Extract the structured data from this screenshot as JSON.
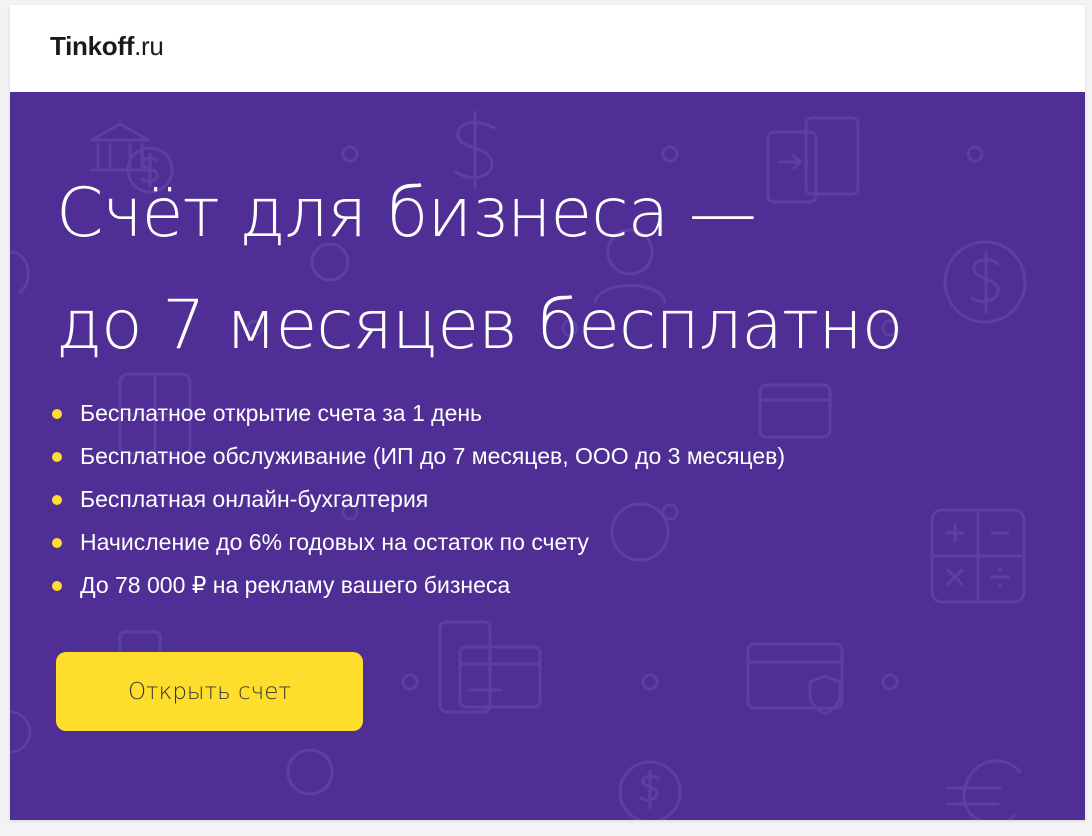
{
  "header": {
    "logo_brand": "Tinkoff",
    "logo_tld": ".ru"
  },
  "banner": {
    "headline_line1": "Счёт для бизнеса —",
    "headline_line2": "до 7 месяцев бесплатно",
    "benefits": [
      "Бесплатное открытие счета за 1 день",
      "Бесплатное обслуживание (ИП до 7 месяцев, ООО до 3 месяцев)",
      "Бесплатная онлайн-бухгалтерия",
      "Начисление до 6% годовых на остаток по счету",
      "До 78 000 ₽ на рекламу вашего бизнеса"
    ],
    "cta_label": "Открыть счет",
    "background_icons": [
      "bank-icon",
      "dollar-icon",
      "tablet-icon",
      "calculator-icon",
      "credit-card-icon",
      "shield-icon",
      "coin-icon",
      "euro-icon",
      "person-icon"
    ]
  },
  "colors": {
    "banner_bg": "#4f2f96",
    "accent": "#ffdd2d",
    "text_light": "#ffffff",
    "text_dark": "#1a1a1a",
    "pattern_stroke": "#5d3fa3"
  }
}
